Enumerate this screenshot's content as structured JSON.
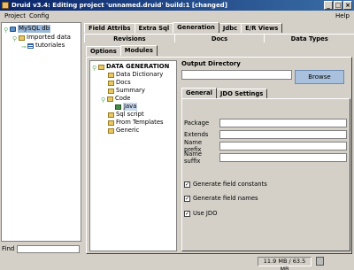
{
  "window": {
    "title": "Druid v3.4: Editing project 'unnamed.druid' build:1 [changed]",
    "buttons": [
      "_",
      "□",
      "×"
    ]
  },
  "menu": {
    "items": [
      "Project",
      "Config"
    ],
    "help": "Help"
  },
  "project_tree": [
    {
      "label": "MySQL db",
      "icon": "database-icon"
    },
    {
      "label": "Imported data",
      "icon": "folder-icon"
    },
    {
      "label": "tutoriales",
      "icon": "table-icon"
    }
  ],
  "find": {
    "label": "Find"
  },
  "top_tabs": [
    "Field Attribs",
    "Extra Sql",
    "Generation",
    "Jdbc",
    "E/R Views"
  ],
  "row2_tabs": [
    "Revisions",
    "Docs",
    "Data Types"
  ],
  "inner_tabs": [
    "Options",
    "Modules"
  ],
  "gen_tree": {
    "root": "DATA GENERATION",
    "items": [
      "Data Dictionary",
      "Docs",
      "Summary",
      "Code"
    ],
    "code_child": "Java",
    "items_after": [
      "Sql script",
      "From Templates",
      "Generic"
    ]
  },
  "output": {
    "title": "Output Directory",
    "value": "",
    "browse_label": "Browse"
  },
  "sub_tabs": [
    "General",
    "JDO Settings"
  ],
  "fields": [
    {
      "label": "Package",
      "value": ""
    },
    {
      "label": "Extends",
      "value": ""
    },
    {
      "label": "Name prefix",
      "value": ""
    },
    {
      "label": "Name suffix",
      "value": ""
    }
  ],
  "checkboxes": [
    {
      "label": "Generate field constants",
      "checked": true
    },
    {
      "label": "Generate field names",
      "checked": true
    },
    {
      "label": "Use JDO",
      "checked": true
    }
  ],
  "status": {
    "memory": "11.9 MB / 63.5 MB"
  }
}
